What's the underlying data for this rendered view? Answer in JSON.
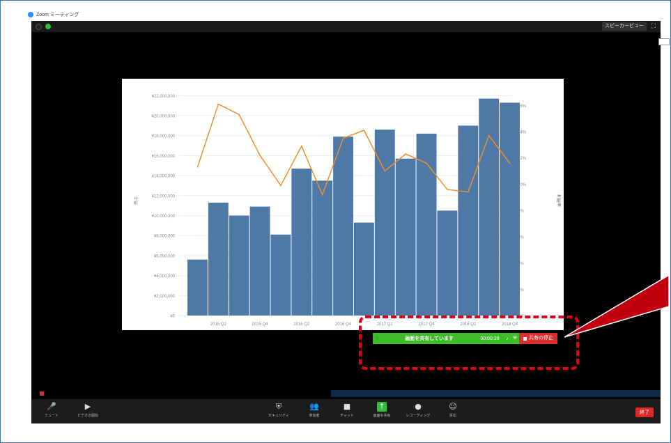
{
  "window_title": "Zoom ミーティング",
  "topbar": {
    "speaker_view": "スピーカービュー"
  },
  "sharebar": {
    "text": "画面を共有しています",
    "timer": "00:00:39",
    "stop_share": "共有の停止"
  },
  "toolbar": {
    "mute": "ミュート",
    "video": "ビデオの開始",
    "security": "セキュリティ",
    "participants": "参加者",
    "chat": "チャット",
    "share_screen": "画面を共有",
    "record": "レコーディング",
    "reactions": "反応",
    "end": "終了"
  },
  "colors": {
    "bar": "#4e79a7",
    "line": "#f28e2b",
    "share_green": "#3fbe2a",
    "stop_red": "#d83030"
  },
  "chart_data": {
    "type": "bar",
    "categories": [
      "2015 Q1",
      "2015 Q2",
      "2015 Q3",
      "2015 Q4",
      "2016 Q1",
      "2016 Q2",
      "2016 Q3",
      "2016 Q4",
      "2017 Q1",
      "2017 Q2",
      "2017 Q3",
      "2017 Q4",
      "2018 Q1",
      "2018 Q2",
      "2018 Q3",
      "2018 Q4"
    ],
    "x_tick_labels": [
      "2015 Q2",
      "2015 Q4",
      "2016 Q2",
      "2016 Q4",
      "2017 Q2",
      "2017 Q4",
      "2018 Q2",
      "2018 Q4"
    ],
    "ylabel": "売上",
    "y2label": "利益率",
    "series": [
      {
        "values": [
          5600000,
          11300000,
          10000000,
          10900000,
          8100000,
          14700000,
          13500000,
          17900000,
          9300000,
          18600000,
          15700000,
          18200000,
          10500000,
          19000000,
          21700000,
          21300000
        ]
      },
      {
        "axis": "right",
        "values": [
          11.3,
          16.1,
          15.3,
          12.2,
          9.9,
          12.9,
          9.2,
          13.5,
          14.1,
          11.0,
          12.3,
          11.6,
          9.6,
          9.4,
          13.7,
          11.6
        ]
      }
    ],
    "y_ticks": [
      "¥0",
      "¥2,000,000",
      "¥4,000,000",
      "¥6,000,000",
      "¥8,000,000",
      "¥10,000,000",
      "¥12,000,000",
      "¥14,000,000",
      "¥16,000,000",
      "¥18,000,000",
      "¥20,000,000",
      "¥22,000,000"
    ],
    "y2_ticks": [
      "0%",
      "2%",
      "4%",
      "6%",
      "8%",
      "10%",
      "12%",
      "14%",
      "16%"
    ],
    "ylim": [
      0,
      23000000
    ],
    "y2lim": [
      0,
      17.5
    ],
    "grid": true
  }
}
